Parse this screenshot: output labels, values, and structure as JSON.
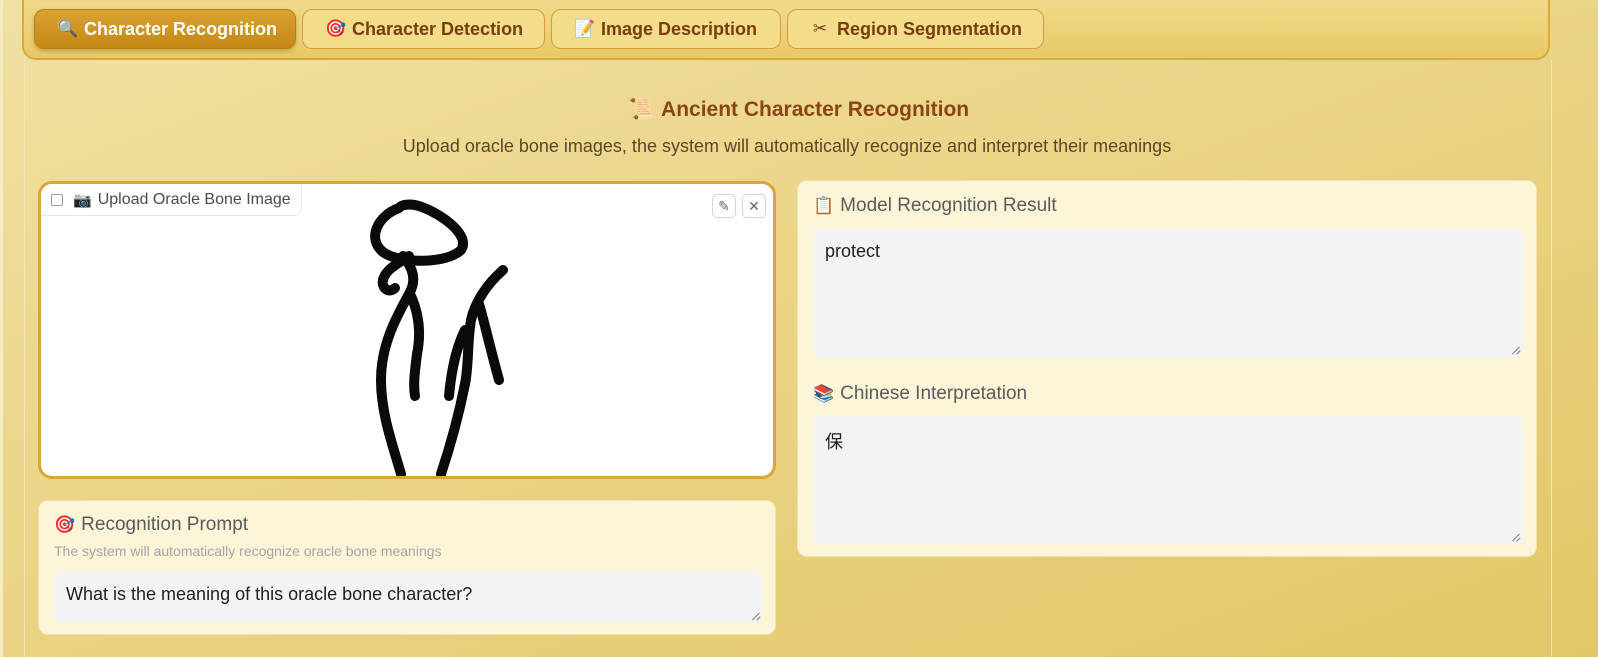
{
  "tabs": [
    {
      "label": "Character Recognition",
      "icon": "🔍",
      "icon_name": "magnifier-icon",
      "active": true
    },
    {
      "label": "Character Detection",
      "icon": "🎯",
      "icon_name": "target-icon",
      "active": false
    },
    {
      "label": "Image Description",
      "icon": "📝",
      "icon_name": "memo-icon",
      "active": false
    },
    {
      "label": "Region Segmentation",
      "icon": "✂",
      "icon_name": "scissors-icon",
      "active": false
    }
  ],
  "header": {
    "title": "Ancient Character Recognition",
    "title_icon": "📜",
    "subtitle": "Upload oracle bone images, the system will automatically recognize and interpret their meanings"
  },
  "upload": {
    "label": "Upload Oracle Bone Image",
    "label_icon": "📷",
    "edit_icon": "✎",
    "close_icon": "✕"
  },
  "prompt": {
    "title": "Recognition Prompt",
    "icon": "🎯",
    "hint": "The system will automatically recognize oracle bone meanings",
    "value": "What is the meaning of this oracle bone character?"
  },
  "result": {
    "title": "Model Recognition Result",
    "icon": "📋",
    "value": "protect"
  },
  "interpretation": {
    "title": "Chinese Interpretation",
    "icon": "📚",
    "value": "保"
  },
  "colors": {
    "accent": "#c48816",
    "title_brown": "#8b4513",
    "card_bg": "#fdf5d8",
    "field_bg": "#f2f3f5"
  }
}
